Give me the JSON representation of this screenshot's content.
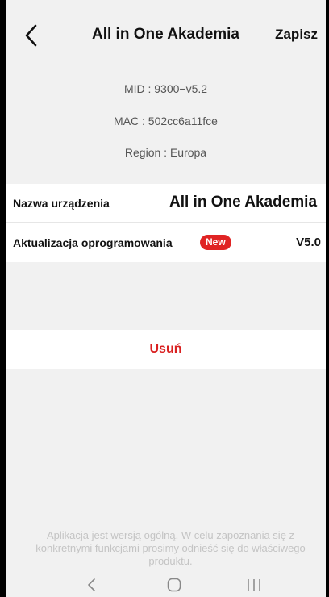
{
  "header": {
    "title": "All in One Akademia",
    "save_label": "Zapisz"
  },
  "info": {
    "mid": "MID : 9300−v5.2",
    "mac": "MAC : 502cc6a11fce",
    "region": "Region : Europa"
  },
  "device_name": {
    "label": "Nazwa urządzenia",
    "value": "All in One Akademia"
  },
  "firmware": {
    "label": "Aktualizacja oprogramowania",
    "badge": "New",
    "value": "V5.0"
  },
  "delete_label": "Usuń",
  "disclaimer": "Aplikacja jest wersją ogólną. W celu zapoznania się z konkretnymi funkcjami prosimy odnieść się do właściwego produktu.",
  "colors": {
    "accent_red": "#d92020",
    "badge_red": "#e02424",
    "background": "#f1f1f1"
  },
  "icons": {
    "back": "chevron-left-icon",
    "nav_back": "nav-back-icon",
    "nav_home": "nav-home-icon",
    "nav_recent": "nav-recent-apps-icon"
  }
}
